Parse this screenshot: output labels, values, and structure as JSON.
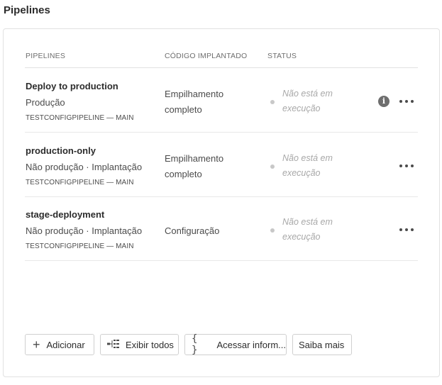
{
  "page": {
    "title": "Pipelines"
  },
  "table": {
    "headers": {
      "pipelines": "PIPELINES",
      "code": "CÓDIGO IMPLANTADO",
      "status": "STATUS"
    },
    "rows": [
      {
        "name": "Deploy to production",
        "env": "Produção",
        "repo": "TESTCONFIGPIPELINE — MAIN",
        "code_line1": "Empilhamento",
        "code_line2": "completo",
        "status_line1": "Não está em",
        "status_line2": "execução",
        "has_info_icon": true
      },
      {
        "name": "production-only",
        "env": "Não produção · Implantação",
        "repo": "TESTCONFIGPIPELINE — MAIN",
        "code_line1": "Empilhamento",
        "code_line2": "completo",
        "status_line1": "Não está em",
        "status_line2": "execução",
        "has_info_icon": false
      },
      {
        "name": "stage-deployment",
        "env": "Não produção · Implantação",
        "repo": "TESTCONFIGPIPELINE — MAIN",
        "code_line1": "Configuração",
        "code_line2": "",
        "status_line1": "Não está em",
        "status_line2": "execução",
        "has_info_icon": false
      }
    ]
  },
  "toolbar": {
    "add_label": "Adicionar",
    "view_all_label": "Exibir todos",
    "access_info_label": "Acessar inform...",
    "learn_more_label": "Saiba mais"
  },
  "icons": {
    "add": "plus-icon",
    "view_all": "list-tree-icon",
    "access_info": "braces-icon",
    "info": "info-icon",
    "more": "more-horizontal-icon"
  }
}
